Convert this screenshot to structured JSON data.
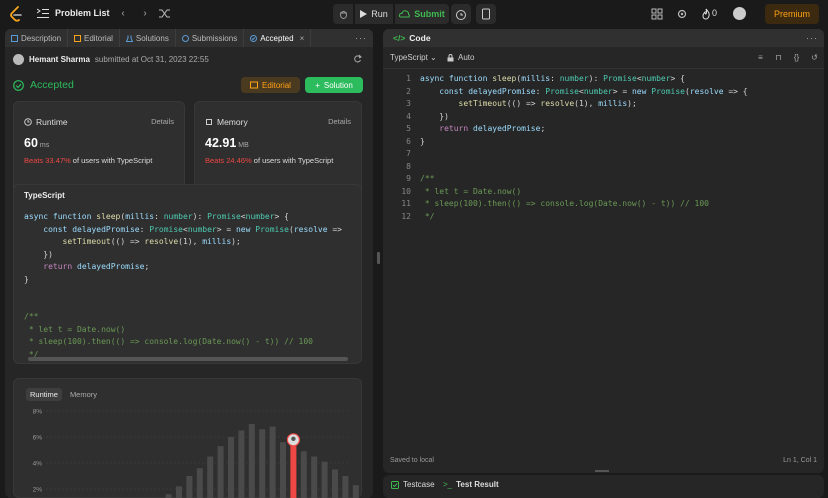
{
  "topbar": {
    "problem_list": "Problem List",
    "run": "Run",
    "submit": "Submit",
    "streak": "0",
    "premium": "Premium"
  },
  "left": {
    "tabs": [
      {
        "label": "Description",
        "icon": "description-icon"
      },
      {
        "label": "Editorial",
        "icon": "book-icon"
      },
      {
        "label": "Solutions",
        "icon": "flask-icon"
      },
      {
        "label": "Submissions",
        "icon": "history-icon"
      },
      {
        "label": "Accepted",
        "icon": "check-circle-icon"
      }
    ],
    "author": "Hemant Sharma",
    "submitted_text": "submitted at Oct 31, 2023 22:55",
    "status": "Accepted",
    "editorial_btn": "Editorial",
    "solution_btn": "Solution",
    "runtime": {
      "label": "Runtime",
      "details": "Details",
      "value": "60",
      "unit": "ms",
      "beats": "Beats 33.47%",
      "beats_suffix": "of users with TypeScript"
    },
    "memory": {
      "label": "Memory",
      "details": "Details",
      "value": "42.91",
      "unit": "MB",
      "beats": "Beats 24.46%",
      "beats_suffix": "of users with TypeScript"
    },
    "code_lang": "TypeScript",
    "chart_tabs": [
      "Runtime",
      "Memory"
    ]
  },
  "code": {
    "tab_label": "Code",
    "language": "TypeScript",
    "auto": "Auto",
    "status_left": "Saved to local",
    "status_right": "Ln 1, Col 1"
  },
  "bottom": {
    "testcase": "Testcase",
    "test_result": "Test Result"
  },
  "colors": {
    "accent_green": "#2cbb5d",
    "accent_orange": "#ffa116",
    "beats_red": "#ef4743"
  },
  "chart_data": {
    "type": "bar",
    "ylabel": "",
    "yticks": [
      "8%",
      "6%",
      "4%",
      "2%"
    ],
    "ylim": [
      0,
      8
    ],
    "values": [
      0.3,
      0.6,
      0.8,
      1.0,
      1.6,
      2.2,
      3.0,
      3.6,
      4.5,
      5.3,
      6.0,
      6.5,
      7.0,
      6.6,
      6.8,
      5.6,
      5.4,
      4.9,
      4.5,
      4.1,
      3.5,
      3.0,
      2.3,
      1.6,
      1.0,
      0.6
    ],
    "highlight_index": 16
  }
}
